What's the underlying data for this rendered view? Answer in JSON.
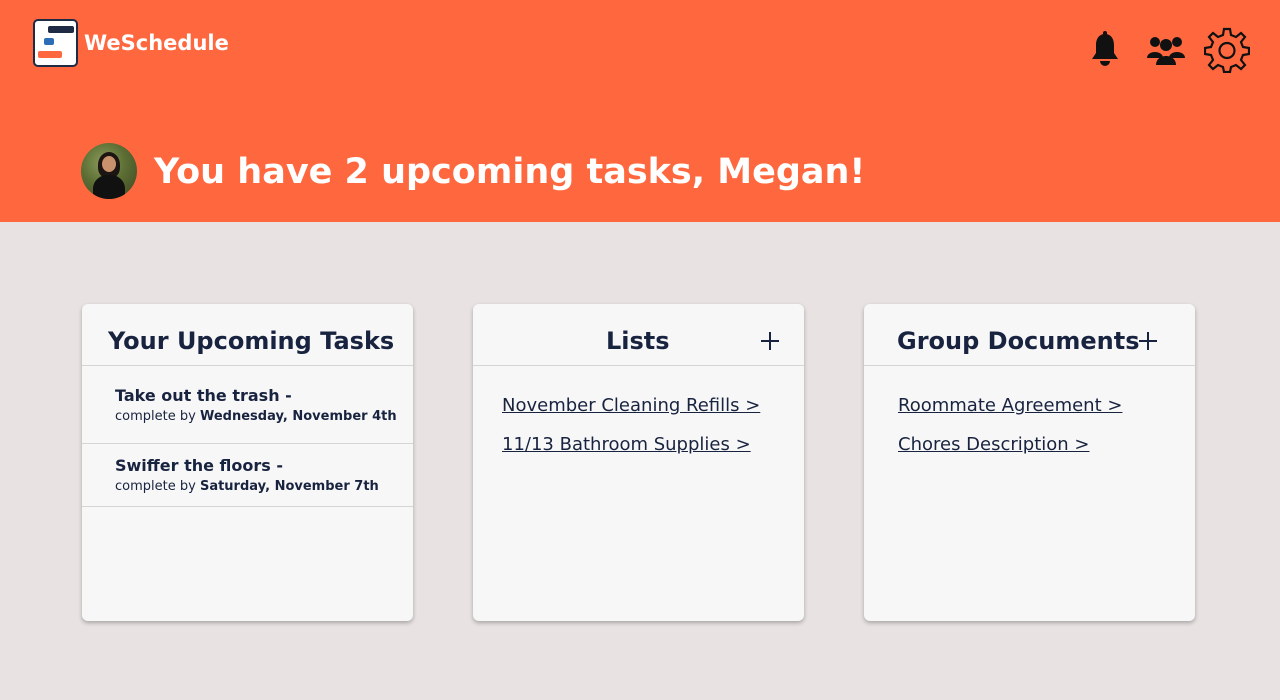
{
  "app": {
    "name": "WeSchedule",
    "brand_color": "#ff683e",
    "text_color": "#18233f"
  },
  "header": {
    "greeting": "You have 2 upcoming tasks, Megan!",
    "icons": [
      "bell-icon",
      "group-icon",
      "gear-icon"
    ]
  },
  "tasks_card": {
    "title": "Your Upcoming Tasks",
    "tasks": [
      {
        "name": "Take out the trash -",
        "due_prefix": "complete by",
        "due_date": "Wednesday, November 4th"
      },
      {
        "name": "Swiffer the floors -",
        "due_prefix": "complete by",
        "due_date": "Saturday, November 7th"
      }
    ]
  },
  "lists_card": {
    "title": "Lists",
    "add_icon": "plus-icon",
    "items": [
      "November Cleaning Refills >",
      "11/13 Bathroom Supplies >"
    ]
  },
  "documents_card": {
    "title": "Group Documents",
    "add_icon": "plus-icon",
    "items": [
      "Roommate Agreement >",
      "Chores Description >"
    ]
  }
}
